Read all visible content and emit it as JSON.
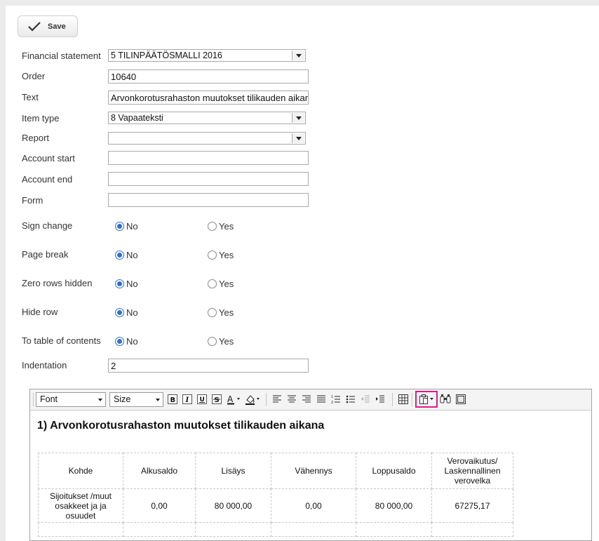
{
  "toolbar": {
    "save_label": "Save"
  },
  "form": {
    "financial_statement": {
      "label": "Financial statement",
      "value": "5 TILINPÄÄTÖSMALLI 2016"
    },
    "order": {
      "label": "Order",
      "value": "10640"
    },
    "text": {
      "label": "Text",
      "value": "Arvonkorotusrahaston muutokset tilikauden aikana"
    },
    "item_type": {
      "label": "Item type",
      "value": "8 Vapaateksti"
    },
    "report": {
      "label": "Report",
      "value": ""
    },
    "account_start": {
      "label": "Account start",
      "value": ""
    },
    "account_end": {
      "label": "Account end",
      "value": ""
    },
    "form_field": {
      "label": "Form",
      "value": ""
    },
    "indentation": {
      "label": "Indentation",
      "value": "2"
    }
  },
  "radios": {
    "no_label": "No",
    "yes_label": "Yes",
    "sign_change": {
      "label": "Sign change",
      "selected": "No"
    },
    "page_break": {
      "label": "Page break",
      "selected": "No"
    },
    "zero_rows_hidden": {
      "label": "Zero rows hidden",
      "selected": "No"
    },
    "hide_row": {
      "label": "Hide row",
      "selected": "No"
    },
    "to_toc": {
      "label": "To table of contents",
      "selected": "No"
    }
  },
  "editor": {
    "font_select": "Font",
    "size_select": "Size",
    "heading": "1) Arvonkorotusrahaston muutokset tilikauden aikana",
    "table": {
      "headers": [
        "Kohde",
        "Alkusaldo",
        "Lisäys",
        "Vähennys",
        "Loppusaldo",
        "Verovaikutus/ Laskennallinen verovelka"
      ],
      "rows": [
        [
          "Sijoitukset /muut osakkeet ja ja osuudet",
          "0,00",
          "80 000,00",
          "0,00",
          "80 000,00",
          "67275,17"
        ]
      ]
    }
  },
  "colors": {
    "accent_radio": "#2f6fd1",
    "highlight_box": "#e0198c"
  }
}
